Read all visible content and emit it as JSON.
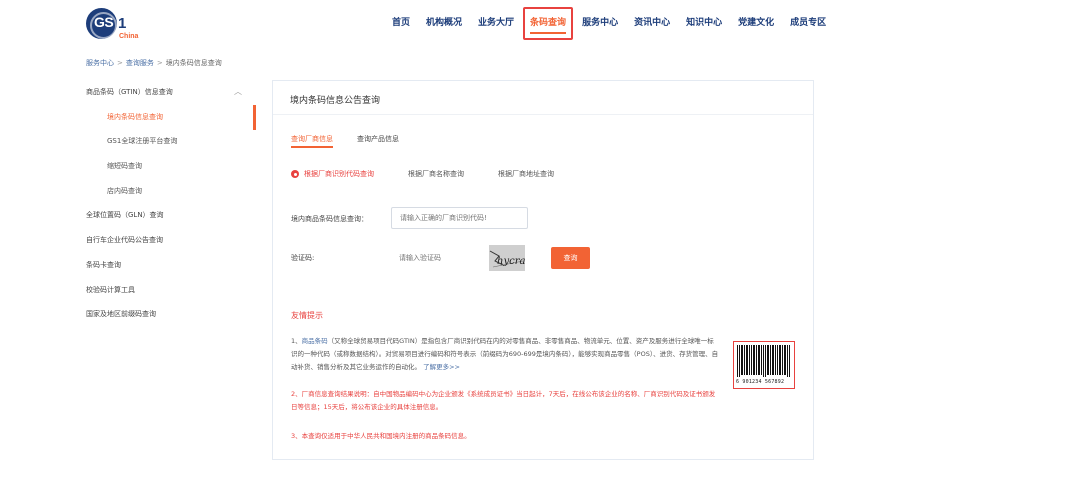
{
  "logo": {
    "mark": "GS",
    "suffix": "1",
    "region": "China"
  },
  "nav": [
    {
      "label": "首页"
    },
    {
      "label": "机构概况"
    },
    {
      "label": "业务大厅"
    },
    {
      "label": "条码查询",
      "active": true
    },
    {
      "label": "服务中心"
    },
    {
      "label": "资讯中心"
    },
    {
      "label": "知识中心"
    },
    {
      "label": "党建文化"
    },
    {
      "label": "成员专区"
    }
  ],
  "breadcrumb": [
    "服务中心",
    "查询服务",
    "境内条码信息查询"
  ],
  "sidebar": {
    "items": [
      {
        "label": "商品条码（GTIN）信息查询",
        "expanded": true
      },
      {
        "label": "境内条码信息查询",
        "sub": true,
        "active": true
      },
      {
        "label": "GS1全球注册平台查询",
        "sub": true
      },
      {
        "label": "缩短码查询",
        "sub": true
      },
      {
        "label": "店内码查询",
        "sub": true
      },
      {
        "label": "全球位置码（GLN）查询"
      },
      {
        "label": "自行车企业代码公告查询"
      },
      {
        "label": "条码卡查询"
      },
      {
        "label": "校验码计算工具"
      },
      {
        "label": "国家及地区前缀码查询"
      }
    ]
  },
  "panel": {
    "title": "境内条码信息公告查询",
    "tabs": [
      {
        "label": "查询厂商信息",
        "active": true
      },
      {
        "label": "查询产品信息"
      }
    ],
    "radios": [
      {
        "label": "根据厂商识别代码查询",
        "checked": true
      },
      {
        "label": "根据厂商名称查询"
      },
      {
        "label": "根据厂商地址查询"
      }
    ],
    "fields": {
      "code_label": "境内商品条码信息查询：",
      "code_placeholder": "请输入正确的厂商识别代码!",
      "captcha_label": "验证码:",
      "captcha_placeholder": "请输入验证码",
      "captcha_text": "hycra",
      "query_label": "查询"
    },
    "tips": {
      "title": "友情提示",
      "tip1_prefix": "1、",
      "tip1_link": "商品条码",
      "tip1_body": "（又称全球贸易项目代码GTIN）是指包含厂商识别代码在内的对零售商品、非零售商品、物流单元、位置、资产及服务进行全球唯一标识的一种代码（或称数据结构）。对贸易项目进行编码和符号表示（前缀码为690-699是境内条码），能够实现商品零售（POS）、进货、存货管理、自动补货、销售分析及其它业务运作的自动化。",
      "tip1_more": "了解更多>>",
      "tip2": "2、厂商信息查询结果说明：自中国物品编码中心为企业颁发《系统成员证书》当日起计，7天后，在线公布该企业的名称、厂商识别代码及证书颁发日等信息；15天后，将公布该企业的具体注册信息。",
      "tip3": "3、本查询仅适用于中华人民共和国境内注册的商品条码信息。"
    },
    "barcode_number": "6 901234 567892"
  },
  "colors": {
    "brand_blue": "#1d3d7a",
    "accent_orange": "#f26334",
    "alert_red": "#e8423f",
    "link_blue": "#4a6fa5"
  }
}
